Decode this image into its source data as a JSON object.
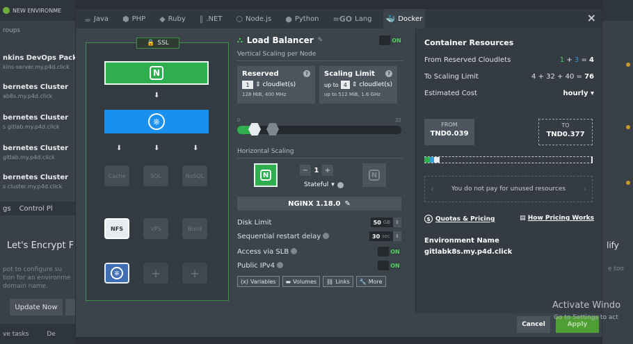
{
  "background": {
    "env_tab": "NEW ENVIRONME",
    "groups_label": "roups",
    "environments": [
      {
        "title": "nkins DevOps Pack",
        "url": "kins-server.my.p4d.click"
      },
      {
        "title": "bernetes Cluster",
        "url": "ab8s.my.p4d.click"
      },
      {
        "title": "bernetes Cluster",
        "url": "s gitlab.my.p4d.click"
      },
      {
        "title": "bernetes Cluster",
        "url": "gitlab.my.p4d.click"
      },
      {
        "title": "bernetes Cluster",
        "url": "s cluster.my.p4d.click"
      }
    ],
    "tabs": [
      "gs",
      "Control Pl"
    ],
    "lets_encrypt": "Let's Encrypt F",
    "note_lines": [
      "pot to configure su",
      "tion for an environme",
      "domain name."
    ],
    "update_button": "Update Now",
    "bottom_tabs": [
      "ve tasks",
      "De"
    ],
    "right_title": "lify",
    "right_note": "e too"
  },
  "lang_tabs": [
    {
      "label": "Java",
      "icon": "java-icon",
      "active": false
    },
    {
      "label": "PHP",
      "icon": "php-icon",
      "active": false
    },
    {
      "label": "Ruby",
      "icon": "ruby-icon",
      "active": false
    },
    {
      "label": ".NET",
      "icon": "dotnet-icon",
      "active": false
    },
    {
      "label": "Node.js",
      "icon": "nodejs-icon",
      "active": false
    },
    {
      "label": "Python",
      "icon": "python-icon",
      "active": false
    },
    {
      "label": "Lang",
      "icon": "go-icon",
      "active": false
    },
    {
      "label": "Docker",
      "icon": "docker-icon",
      "active": true
    }
  ],
  "topology": {
    "ssl_label": "SSL",
    "slots": [
      "Cache",
      "SQL",
      "NoSQL",
      "NFS",
      "VPS",
      "Build"
    ]
  },
  "balancer": {
    "title": "Load Balancer",
    "toggle": "ON",
    "vertical_label": "Vertical Scaling per Node",
    "reserved": {
      "title": "Reserved",
      "value": "1",
      "unit": "cloudlet(s)",
      "sub": "128 MiB, 400 MHz"
    },
    "limit": {
      "title": "Scaling Limit",
      "prefix": "up to",
      "value": "4",
      "unit": "cloudlet(s)",
      "sub": "up to 512 MiB, 1.6 GHz"
    },
    "slider_min": "0",
    "slider_max": "32",
    "horizontal_label": "Horizontal Scaling",
    "node_count": "1",
    "stateful_label": "Stateful",
    "version": "NGINX 1.18.0",
    "disk_label": "Disk Limit",
    "disk_value": "50",
    "disk_unit": "GB",
    "restart_label": "Sequential restart delay",
    "restart_value": "30",
    "restart_unit": "sec",
    "slb_label": "Access via SLB",
    "slb_toggle": "ON",
    "ipv4_label": "Public IPv4",
    "ipv4_toggle": "ON",
    "buttons": [
      "Variables",
      "Volumes",
      "Links",
      "More"
    ]
  },
  "resources": {
    "title": "Container Resources",
    "reserved_label": "From Reserved Cloudlets",
    "reserved_a": "1",
    "reserved_b": "3",
    "reserved_total": "4",
    "limit_label": "To Scaling Limit",
    "limit_expr": "4 + 32 + 40 =",
    "limit_total": "76",
    "cost_label": "Estimated Cost",
    "cost_period": "hourly",
    "from_label": "FROM",
    "from_value": "TND0.039",
    "to_label": "TO",
    "to_value": "TND0.377",
    "unused_note": "You do not pay for unused resources",
    "quotas_link": "Quotas & Pricing",
    "pricing_link": "How Pricing Works",
    "env_name_label": "Environment Name",
    "env_name_value": "gitlabk8s.my.p4d.click"
  },
  "footer": {
    "cancel": "Cancel",
    "apply": "Apply"
  },
  "watermark": {
    "line1": "Activate Windo",
    "line2": "Go to Settings to act"
  }
}
